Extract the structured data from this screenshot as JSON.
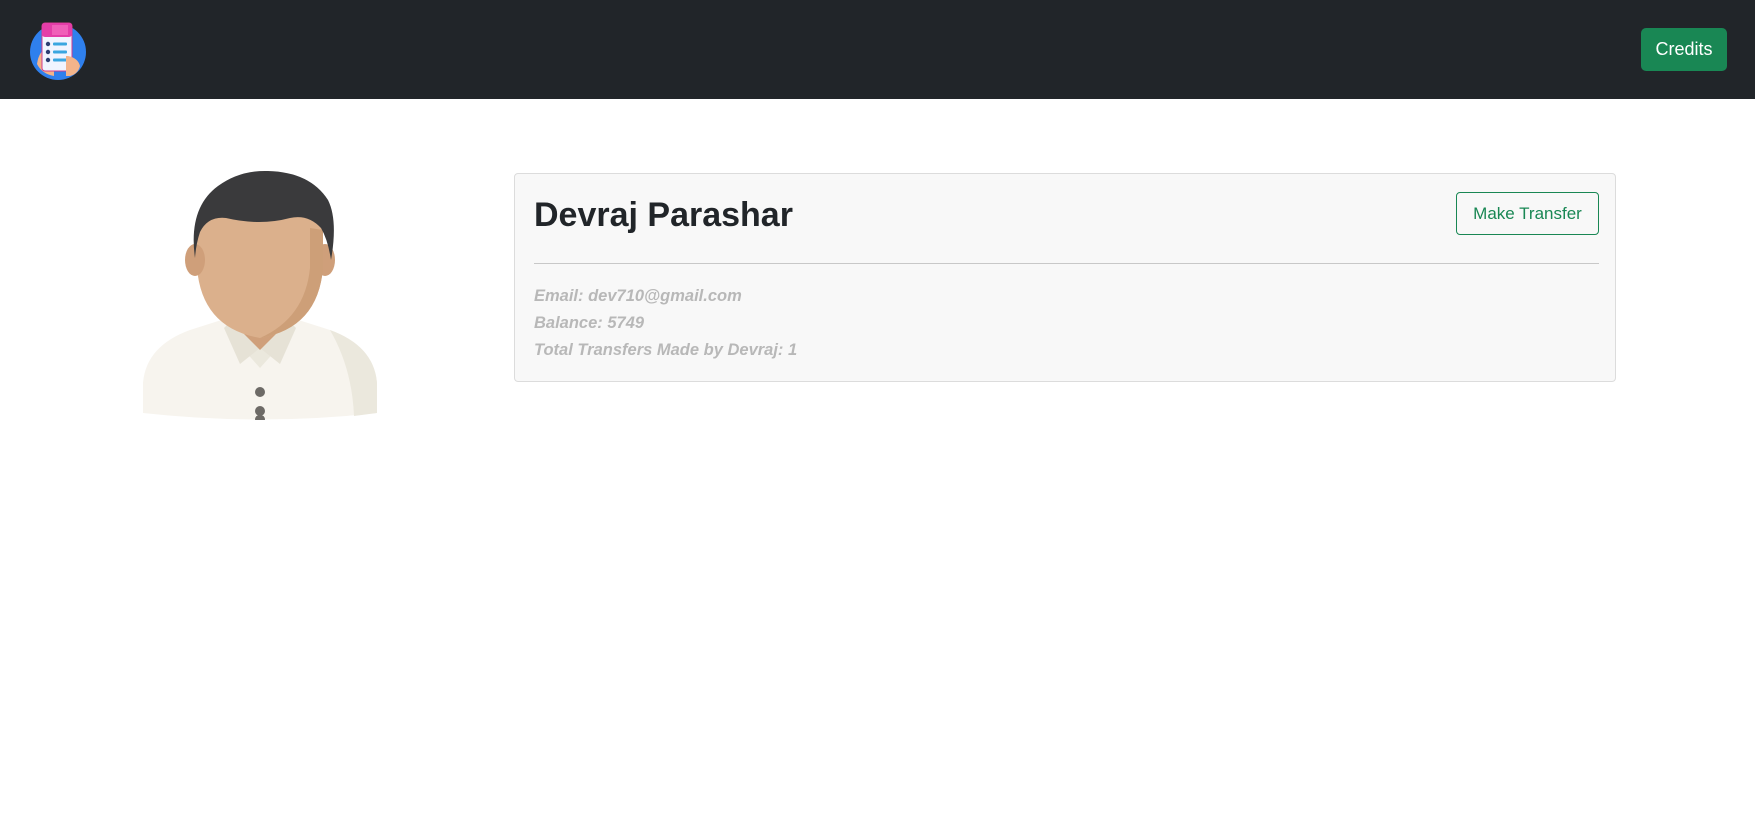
{
  "navbar": {
    "logo_icon": "phone-checklist-logo-icon",
    "credits_label": "Credits",
    "background": "#212529",
    "credits_color": "#198754"
  },
  "profile": {
    "avatar_icon": "user-avatar-icon",
    "name": "Devraj Parashar",
    "transfer_label": "Make Transfer",
    "email_line": "Email: dev710@gmail.com",
    "balance_line": "Balance: 5749",
    "transfers_line": "Total Transfers Made by Devraj: 1"
  }
}
